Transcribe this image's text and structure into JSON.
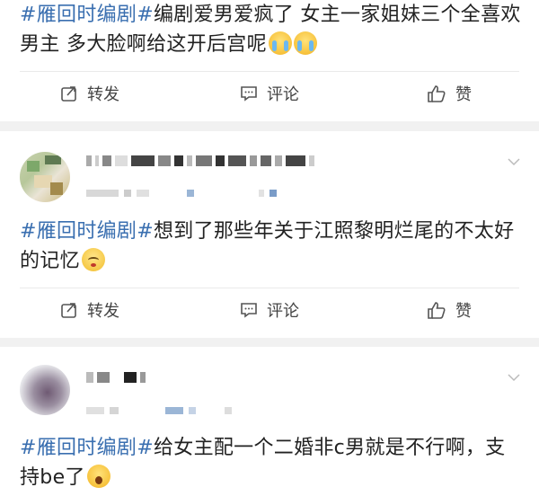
{
  "posts": [
    {
      "hashtag": "#雁回时编剧#",
      "body_line1": "编剧爱男爱疯了 女主一家姐妹三个全喜欢",
      "body_line2": "男主 多大脸啊给这开后宫呢",
      "emojis": [
        "cry-emoji",
        "cry-emoji"
      ]
    },
    {
      "hashtag": "#雁回时编剧#",
      "body_line1": "想到了那些年关于江照黎明烂尾的不太好",
      "body_line2": "的记忆",
      "emojis": [
        "shy-emoji"
      ]
    },
    {
      "hashtag": "#雁回时编剧#",
      "body_line1": "给女主配一个二婚非c男就是不行啊，支",
      "body_line2": "持be了",
      "emojis": [
        "shock-emoji"
      ]
    }
  ],
  "actions": {
    "repost": "转发",
    "comment": "评论",
    "like": "赞"
  },
  "colors": {
    "hashtag": "#3a6fb0",
    "background": "#f1f1f1",
    "card": "#ffffff"
  }
}
